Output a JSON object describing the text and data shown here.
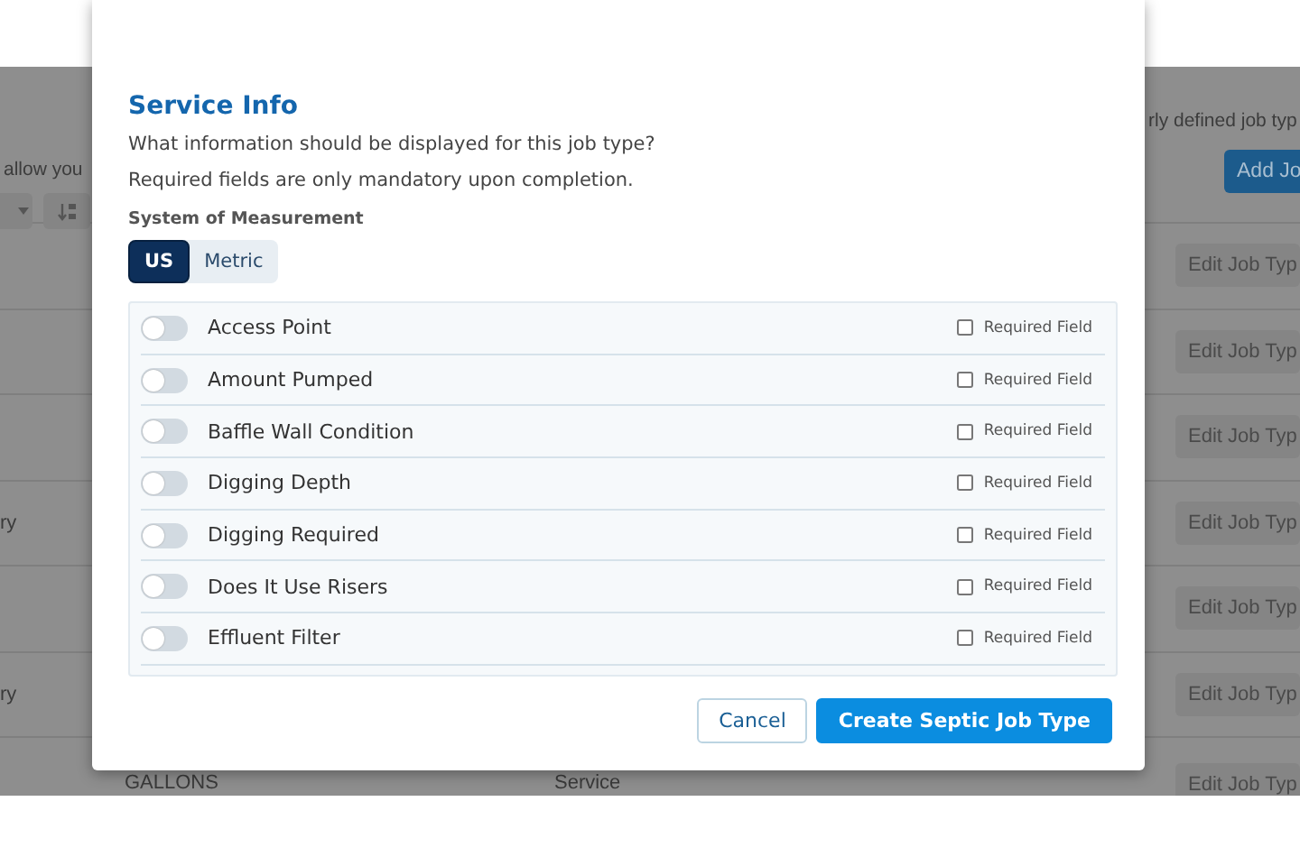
{
  "background": {
    "intro_left": "allow you",
    "intro_right": "rly defined job typ",
    "add_button": "Add Jo",
    "rows": [
      {
        "col_1": "",
        "col_2": "",
        "col_3": "",
        "edit_button": "Edit Job Typ"
      },
      {
        "col_1": "",
        "col_2": "",
        "col_3": "",
        "edit_button": "Edit Job Typ"
      },
      {
        "col_1": "",
        "col_2": "",
        "col_3": "",
        "edit_button": "Edit Job Typ"
      },
      {
        "col_1": "ry",
        "col_2": "",
        "col_3": "",
        "edit_button": "Edit Job Typ"
      },
      {
        "col_1": "",
        "col_2": "",
        "col_3": "",
        "edit_button": "Edit Job Typ"
      },
      {
        "col_1": "ry",
        "col_2": "",
        "col_3": "",
        "edit_button": "Edit Job Typ"
      },
      {
        "col_1": "",
        "col_2": "GALLONS",
        "col_3": "Service",
        "edit_button": "Edit Job Typ"
      }
    ]
  },
  "modal": {
    "title": "Service Info",
    "description": [
      "What information should be displayed for this job type?",
      "Required fields are only mandatory upon completion."
    ],
    "measurement_label": "System of Measurement",
    "measurement_options": [
      {
        "label": "US",
        "selected": true
      },
      {
        "label": "Metric",
        "selected": false
      }
    ],
    "fields": [
      {
        "label": "Access Point",
        "on": false,
        "required_label": "Required Field",
        "checked": false
      },
      {
        "label": "Amount Pumped",
        "on": false,
        "required_label": "Required Field",
        "checked": false
      },
      {
        "label": "Baffle Wall Condition",
        "on": false,
        "required_label": "Required Field",
        "checked": false
      },
      {
        "label": "Digging Depth",
        "on": false,
        "required_label": "Required Field",
        "checked": false
      },
      {
        "label": "Digging Required",
        "on": false,
        "required_label": "Required Field",
        "checked": false
      },
      {
        "label": "Does It Use Risers",
        "on": false,
        "required_label": "Required Field",
        "checked": false
      },
      {
        "label": "Effluent Filter",
        "on": false,
        "required_label": "Required Field",
        "checked": false
      }
    ],
    "buttons": [
      {
        "kind": "secondary",
        "label": "Cancel"
      },
      {
        "kind": "primary",
        "label": "Create Septic Job Type"
      }
    ]
  }
}
